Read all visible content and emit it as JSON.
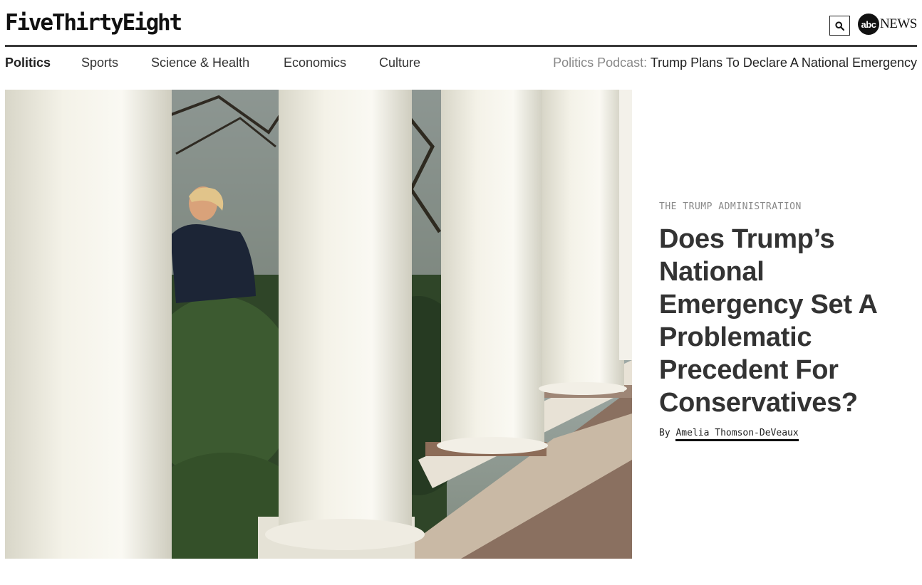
{
  "header": {
    "logo": "FiveThirtyEight",
    "search_icon": "search-icon",
    "partner_logo": {
      "mark": "abc",
      "text": "NEWS"
    }
  },
  "nav": {
    "items": [
      {
        "label": "Politics",
        "active": true
      },
      {
        "label": "Sports",
        "active": false
      },
      {
        "label": "Science & Health",
        "active": false
      },
      {
        "label": "Economics",
        "active": false
      },
      {
        "label": "Culture",
        "active": false
      }
    ],
    "podcast": {
      "prefix": "Politics Podcast:",
      "title": "Trump Plans To Declare A National Emergency"
    }
  },
  "featured": {
    "kicker": "THE TRUMP ADMINISTRATION",
    "headline": "Does Trump’s National Emergency Set A Problematic Precedent For Conservatives?",
    "byline_prefix": "By",
    "author": "Amelia Thomson-DeVeaux"
  },
  "colors": {
    "rule": "#3a3a3a",
    "headline": "#333333",
    "muted": "#888888"
  }
}
